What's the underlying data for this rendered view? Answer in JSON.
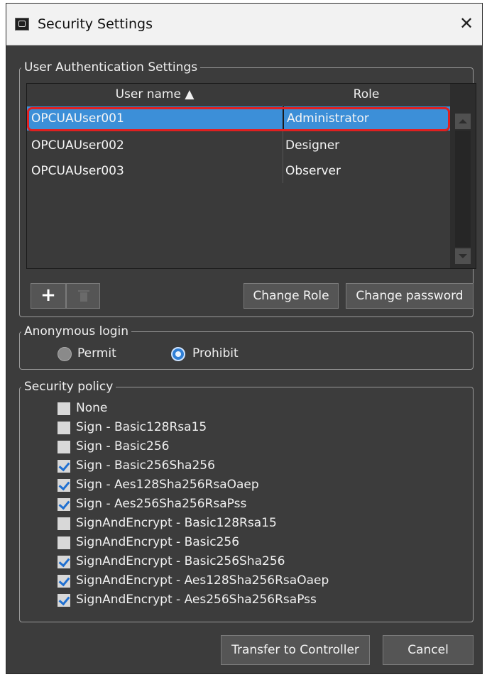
{
  "window": {
    "title": "Security Settings",
    "close_glyph": "✕"
  },
  "user_auth": {
    "legend": "User Authentication Settings",
    "columns": {
      "user": "User name ▲",
      "role": "Role"
    },
    "rows": [
      {
        "user": "OPCUAUser001",
        "role": "Administrator",
        "selected": true
      },
      {
        "user": "OPCUAUser002",
        "role": "Designer",
        "selected": false
      },
      {
        "user": "OPCUAUser003",
        "role": "Observer",
        "selected": false
      }
    ],
    "add_label": "+",
    "change_role": "Change Role",
    "change_password": "Change password"
  },
  "anonymous": {
    "legend": "Anonymous login",
    "options": [
      {
        "label": "Permit",
        "selected": false
      },
      {
        "label": "Prohibit",
        "selected": true
      }
    ]
  },
  "security_policy": {
    "legend": "Security policy",
    "items": [
      {
        "label": "None",
        "checked": false
      },
      {
        "label": "Sign - Basic128Rsa15",
        "checked": false
      },
      {
        "label": "Sign - Basic256",
        "checked": false
      },
      {
        "label": "Sign - Basic256Sha256",
        "checked": true
      },
      {
        "label": "Sign - Aes128Sha256RsaOaep",
        "checked": true
      },
      {
        "label": "Sign - Aes256Sha256RsaPss",
        "checked": true
      },
      {
        "label": "SignAndEncrypt - Basic128Rsa15",
        "checked": false
      },
      {
        "label": "SignAndEncrypt - Basic256",
        "checked": false
      },
      {
        "label": "SignAndEncrypt - Basic256Sha256",
        "checked": true
      },
      {
        "label": "SignAndEncrypt - Aes128Sha256RsaOaep",
        "checked": true
      },
      {
        "label": "SignAndEncrypt - Aes256Sha256RsaPss",
        "checked": true
      }
    ]
  },
  "footer": {
    "transfer": "Transfer to Controller",
    "cancel": "Cancel"
  },
  "colors": {
    "selection": "#3c8fd8",
    "highlight": "#e02020",
    "dialog_bg": "#3c3c3c"
  }
}
